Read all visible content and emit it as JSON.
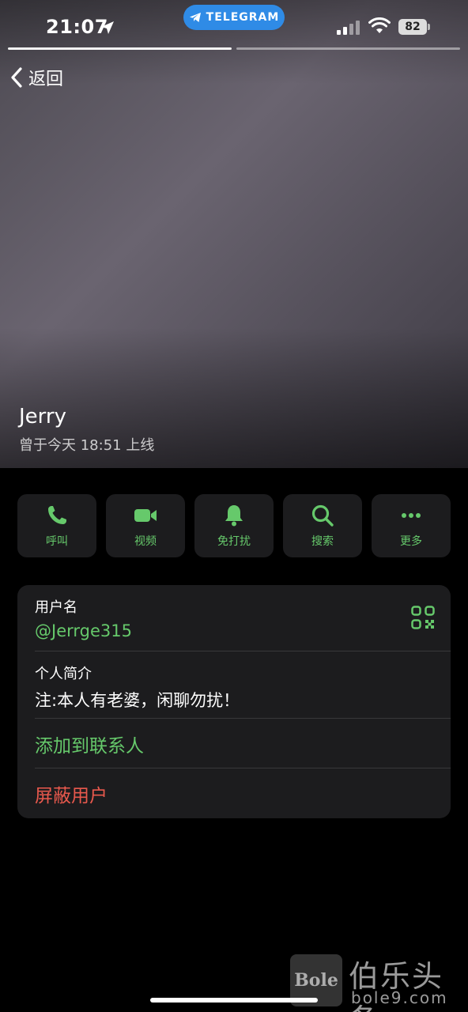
{
  "status_bar": {
    "time": "21:07",
    "app_pill": "TELEGRAM",
    "battery": "82"
  },
  "nav": {
    "back_label": "返回"
  },
  "profile": {
    "name": "Jerry",
    "last_seen": "曾于今天 18:51 上线"
  },
  "actions": [
    {
      "label": "呼叫",
      "icon": "phone-icon"
    },
    {
      "label": "视频",
      "icon": "video-icon"
    },
    {
      "label": "免打扰",
      "icon": "bell-icon"
    },
    {
      "label": "搜索",
      "icon": "search-icon"
    },
    {
      "label": "更多",
      "icon": "more-icon"
    }
  ],
  "info": {
    "username_label": "用户名",
    "username_value": "@Jerrge315",
    "bio_label": "个人简介",
    "bio_value": "注:本人有老婆，闲聊勿扰！",
    "add_contact": "添加到联系人",
    "block_user": "屏蔽用户"
  },
  "watermark": {
    "logo": "Bole",
    "name": "伯乐头条",
    "url": "bole9.com"
  },
  "colors": {
    "accent_green": "#66c96b",
    "danger_red": "#e9594d",
    "telegram_blue": "#2f8be6"
  }
}
